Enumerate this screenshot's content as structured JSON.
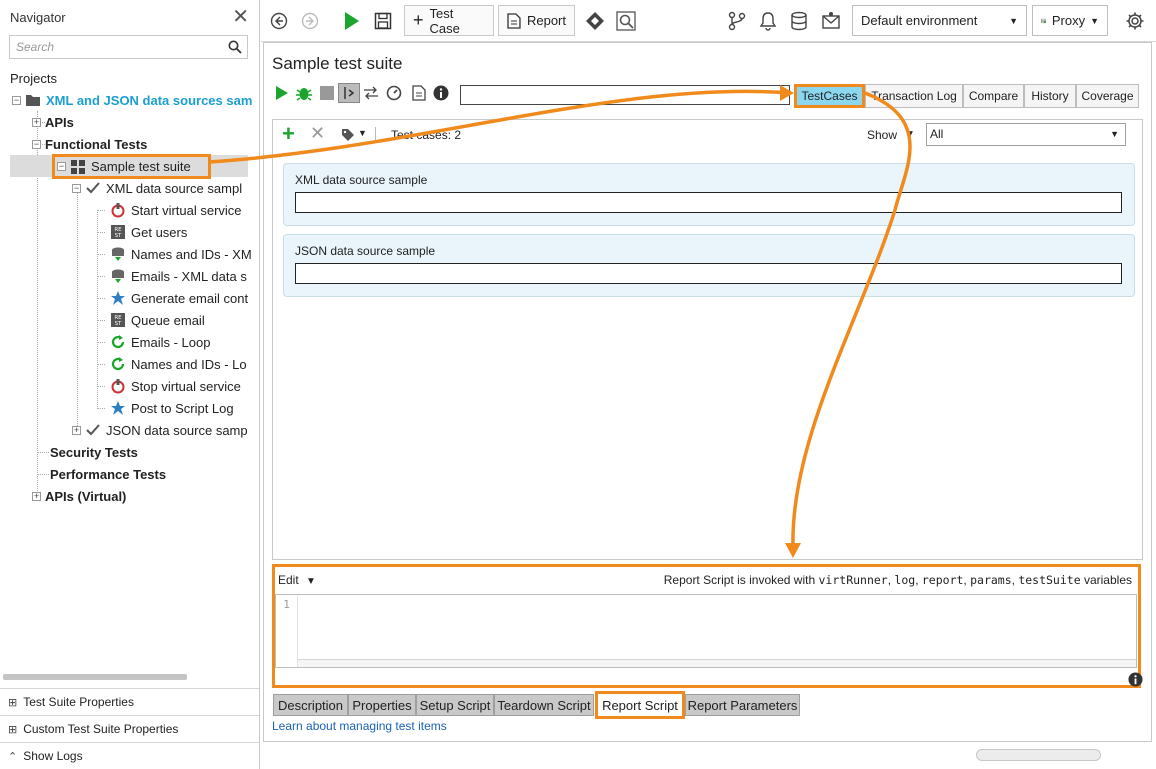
{
  "navigator": {
    "title": "Navigator",
    "search_placeholder": "Search",
    "projects_label": "Projects",
    "tree": {
      "project": "XML and JSON data sources sam",
      "apis": "APIs",
      "functional_tests": "Functional Tests",
      "suite": "Sample test suite",
      "case_xml": "XML data source sampl",
      "steps": [
        "Start virtual service",
        "Get users",
        "Names and IDs - XM",
        "Emails - XML data s",
        "Generate email cont",
        "Queue email",
        "Emails - Loop",
        "Names and IDs - Lo",
        "Stop virtual service",
        "Post to Script Log"
      ],
      "case_json": "JSON data source samp",
      "security_tests": "Security Tests",
      "performance_tests": "Performance Tests",
      "apis_virtual": "APIs (Virtual)"
    },
    "bottom": {
      "suite_props": "Test Suite Properties",
      "custom_props": "Custom Test Suite Properties",
      "show_logs": "Show Logs"
    }
  },
  "toolbar": {
    "test_case": "Test Case",
    "report": "Report",
    "environment": "Default environment",
    "proxy": "Proxy"
  },
  "editor": {
    "title": "Sample test suite",
    "tabs": [
      "TestCases",
      "Transaction Log",
      "Compare",
      "History",
      "Coverage"
    ],
    "testcases_count": "Test cases: 2",
    "show_label": "Show",
    "show_value": "All",
    "cases": [
      "XML data source sample",
      "JSON data source sample"
    ],
    "script": {
      "edit_label": "Edit",
      "note_prefix": "Report Script is invoked with",
      "vars": [
        "virtRunner",
        "log",
        "report",
        "params",
        "testSuite"
      ],
      "note_suffix": "variables",
      "line_number": "1"
    },
    "bottom_tabs": [
      "Description",
      "Properties",
      "Setup Script",
      "Teardown Script",
      "Report Script",
      "Report Parameters"
    ],
    "learn_link": "Learn about managing test items"
  },
  "colors": {
    "highlight": "#f08a1c",
    "active_tab": "#8bd7ef",
    "card": "#e9f5fb",
    "run_green": "#1aa52c",
    "link": "#1a63b5"
  }
}
